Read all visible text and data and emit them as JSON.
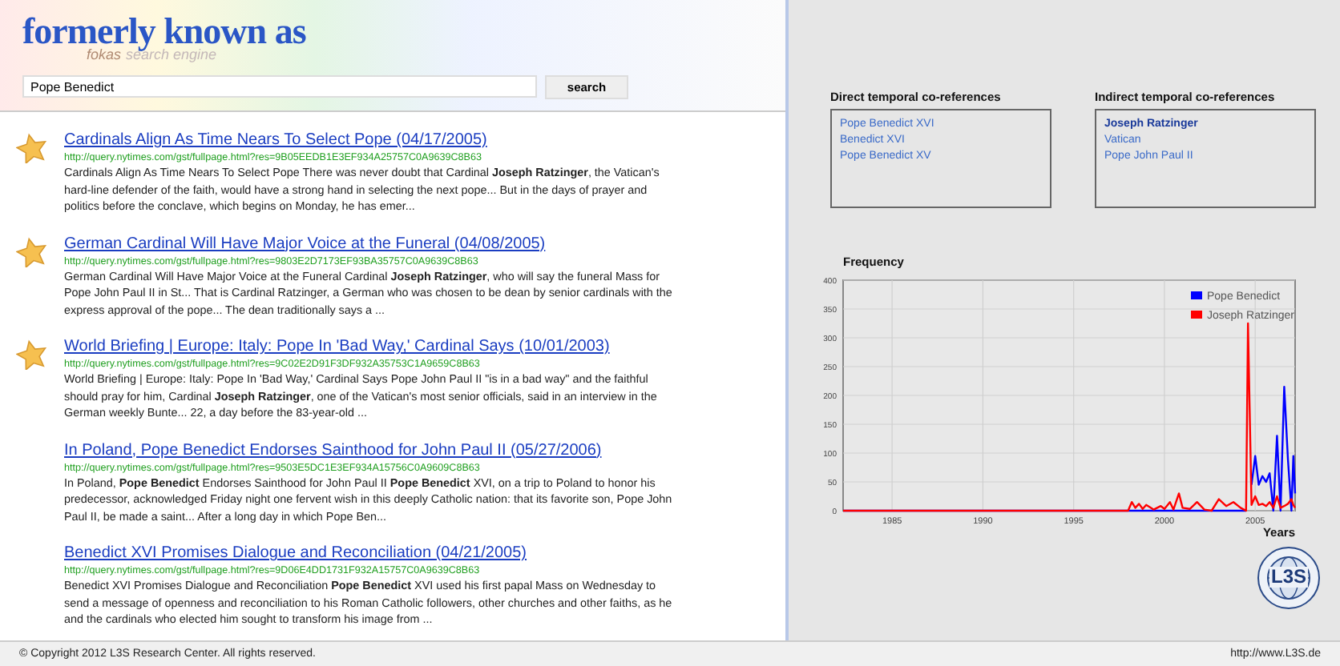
{
  "logo": {
    "title": "formerly known as",
    "subtitle_brand": "fokas",
    "subtitle_rest": "search engine"
  },
  "search": {
    "value": "Pope Benedict",
    "button": "search"
  },
  "results": [
    {
      "starred": true,
      "title": "Cardinals Align As Time Nears To Select Pope (04/17/2005)",
      "url": "http://query.nytimes.com/gst/fullpage.html?res=9B05EEDB1E3EF934A25757C0A9639C8B63",
      "snippet": "Cardinals Align As Time Nears To Select Pope There was never doubt that Cardinal **Joseph Ratzinger**, the Vatican's hard-line defender of the faith, would have a strong hand in selecting the next pope... But in the days of prayer and politics before the conclave, which begins on Monday, he has emer..."
    },
    {
      "starred": true,
      "title": "German Cardinal Will Have Major Voice at the Funeral (04/08/2005)",
      "url": "http://query.nytimes.com/gst/fullpage.html?res=9803E2D7173EF93BA35757C0A9639C8B63",
      "snippet": "German Cardinal Will Have Major Voice at the Funeral Cardinal **Joseph Ratzinger**, who will say the funeral Mass for Pope John Paul II in St... That is Cardinal Ratzinger, a German who was chosen to be dean by senior cardinals with the express approval of the pope... The dean traditionally says a ..."
    },
    {
      "starred": true,
      "title": "World Briefing | Europe: Italy: Pope In 'Bad Way,' Cardinal Says (10/01/2003)",
      "url": "http://query.nytimes.com/gst/fullpage.html?res=9C02E2D91F3DF932A35753C1A9659C8B63",
      "snippet": "World Briefing | Europe: Italy: Pope In 'Bad Way,' Cardinal Says Pope John Paul II \"is in a bad way\" and the faithful should pray for him, Cardinal **Joseph Ratzinger**, one of the Vatican's most senior officials, said in an interview in the German weekly Bunte... 22, a day before the 83-year-old ..."
    },
    {
      "starred": false,
      "title": "In Poland, Pope Benedict Endorses Sainthood for John Paul II (05/27/2006)",
      "url": "http://query.nytimes.com/gst/fullpage.html?res=9503E5DC1E3EF934A15756C0A9609C8B63",
      "snippet": "In Poland, **Pope Benedict** Endorses Sainthood for John Paul II **Pope Benedict** XVI, on a trip to Poland to honor his predecessor, acknowledged Friday night one fervent wish in this deeply Catholic nation: that its favorite son, Pope John Paul II, be made a saint... After a long day in which Pope Ben..."
    },
    {
      "starred": false,
      "title": "Benedict XVI Promises Dialogue and Reconciliation (04/21/2005)",
      "url": "http://query.nytimes.com/gst/fullpage.html?res=9D06E4DD1731F932A15757C0A9639C8B63",
      "snippet": "Benedict XVI Promises Dialogue and Reconciliation **Pope Benedict** XVI used his first papal Mass on Wednesday to send a message of openness and reconciliation to his Roman Catholic followers, other churches and other faiths, as he and the cardinals who elected him sought to transform his image from ..."
    }
  ],
  "direct": {
    "title": "Direct temporal co-references",
    "items": [
      {
        "label": "Pope Benedict XVI",
        "highlighted": false
      },
      {
        "label": "Benedict XVI",
        "highlighted": false
      },
      {
        "label": "Pope Benedict XV",
        "highlighted": false
      }
    ]
  },
  "indirect": {
    "title": "Indirect temporal co-references",
    "items": [
      {
        "label": "Joseph Ratzinger",
        "highlighted": true
      },
      {
        "label": "Vatican",
        "highlighted": false
      },
      {
        "label": "Pope John Paul II",
        "highlighted": false
      }
    ]
  },
  "frequency": {
    "chart_data": {
      "type": "line",
      "grid": true,
      "legend": true,
      "ylabel": "Frequency",
      "xlabel": "Years",
      "xlim": [
        1982.3,
        2007.2
      ],
      "ylim": [
        0,
        400
      ],
      "xticks": [
        1985,
        1990,
        1995,
        2000,
        2005
      ],
      "yticks": [
        0,
        50,
        100,
        150,
        200,
        250,
        300,
        350,
        400
      ],
      "x": [
        1982.3,
        1998,
        1998.2,
        1998.4,
        1998.6,
        1998.8,
        1999,
        1999.4,
        1999.8,
        2000,
        2000.3,
        2000.5,
        2000.8,
        2001,
        2001.4,
        2001.8,
        2002.2,
        2002.6,
        2003,
        2003.4,
        2003.8,
        2004.2,
        2004.5,
        2004.6,
        2004.8,
        2005,
        2005.2,
        2005.4,
        2005.6,
        2005.8,
        2006,
        2006.2,
        2006.4,
        2006.6,
        2006.8,
        2007,
        2007.1,
        2007.2
      ],
      "series": [
        {
          "name": "Pope Benedict",
          "color": "#0000ff",
          "values": [
            0,
            0,
            0,
            0,
            0,
            0,
            0,
            0,
            0,
            0,
            0,
            0,
            0,
            0,
            0,
            0,
            0,
            0,
            0,
            0,
            0,
            0,
            0,
            null,
            45,
            95,
            45,
            60,
            50,
            65,
            0,
            130,
            0,
            215,
            90,
            0,
            95,
            30
          ]
        },
        {
          "name": "Joseph Ratzinger",
          "color": "#ff0000",
          "values": [
            0,
            0,
            15,
            5,
            12,
            3,
            10,
            2,
            8,
            3,
            15,
            2,
            30,
            5,
            3,
            15,
            2,
            0,
            20,
            8,
            15,
            5,
            0,
            325,
            10,
            25,
            10,
            12,
            8,
            15,
            5,
            25,
            5,
            8,
            12,
            20,
            10,
            5
          ]
        }
      ]
    }
  },
  "badge": {
    "text": "L3S"
  },
  "footer": {
    "copyright": "© Copyright 2012 L3S Research Center. All rights reserved.",
    "link": "http://www.L3S.de"
  }
}
